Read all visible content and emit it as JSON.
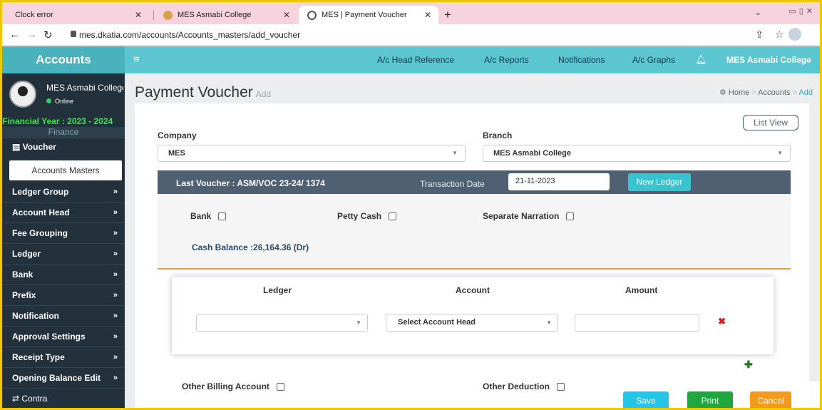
{
  "browser": {
    "tabs": [
      {
        "label": "Clock error"
      },
      {
        "label": "MES Asmabi College"
      },
      {
        "label": "MES | Payment Voucher"
      }
    ],
    "url": "mes.dkatia.com/accounts/Accounts_masters/add_voucher"
  },
  "topnav": {
    "brand": "Accounts",
    "items": [
      "A/c Head Reference",
      "A/c Reports",
      "Notifications",
      "A/c Graphs"
    ],
    "college": "MES Asmabi College"
  },
  "sidebar": {
    "profile_name": "MES Asmabi College",
    "status": "Online",
    "financial_year": "Financial Year : 2023 - 2024",
    "finance": "Finance",
    "voucher": "Voucher",
    "accounts_masters": "Accounts Masters",
    "items": [
      "Ledger Group",
      "Account Head",
      "Fee Grouping",
      "Ledger",
      "Bank",
      "Prefix",
      "Notification",
      "Approval Settings",
      "Receipt Type",
      "Opening Balance Edit"
    ],
    "contra": "Contra"
  },
  "page": {
    "title": "Payment Voucher",
    "subtitle": "Add",
    "breadcrumb": {
      "home": "Home",
      "accounts": "Accounts",
      "add": "Add"
    },
    "list_view": "List View"
  },
  "form": {
    "company_label": "Company",
    "company_value": "MES",
    "branch_label": "Branch",
    "branch_value": "MES Asmabi College",
    "last_voucher": "Last Voucher : ASM/VOC 23-24/ 1374",
    "transaction_date_label": "Transaction Date",
    "transaction_date": "21-11-2023",
    "new_ledger": "New Ledger",
    "bank": "Bank",
    "petty_cash": "Petty Cash",
    "separate_narration": "Separate Narration",
    "cash_balance": "Cash Balance :26,164.36 (Dr)",
    "col_ledger": "Ledger",
    "col_account": "Account",
    "col_amount": "Amount",
    "account_placeholder": "Select Account Head",
    "other_billing": "Other Billing Account",
    "other_deduction": "Other Deduction"
  },
  "actions": {
    "save": "Save",
    "print": "Print",
    "cancel": "Cancel"
  },
  "colors": {
    "teal": "#5bc6cf",
    "sidebar": "#22313c",
    "save": "#24c6e8",
    "print": "#1fa63f",
    "cancel": "#f39a1a"
  }
}
